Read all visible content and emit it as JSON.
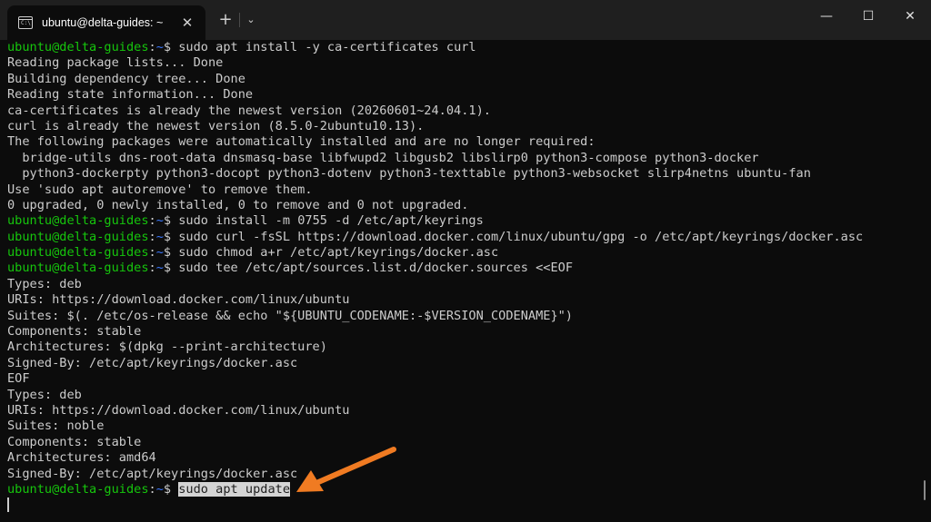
{
  "window": {
    "tab_title": "ubuntu@delta-guides: ~",
    "tab_close": "✕",
    "new_tab": "+",
    "dropdown": "⌄",
    "minimize": "—",
    "maximize": "☐",
    "close": "✕"
  },
  "prompt": {
    "user_host": "ubuntu@delta-guides",
    "separator": ":",
    "path": "~",
    "symbol": "$ "
  },
  "lines": [
    {
      "type": "cmd",
      "text": "sudo apt install -y ca-certificates curl"
    },
    {
      "type": "out",
      "text": "Reading package lists... Done"
    },
    {
      "type": "out",
      "text": "Building dependency tree... Done"
    },
    {
      "type": "out",
      "text": "Reading state information... Done"
    },
    {
      "type": "out",
      "text": "ca-certificates is already the newest version (20260601~24.04.1)."
    },
    {
      "type": "out",
      "text": "curl is already the newest version (8.5.0-2ubuntu10.13)."
    },
    {
      "type": "out",
      "text": "The following packages were automatically installed and are no longer required:"
    },
    {
      "type": "out",
      "text": "  bridge-utils dns-root-data dnsmasq-base libfwupd2 libgusb2 libslirp0 python3-compose python3-docker"
    },
    {
      "type": "out",
      "text": "  python3-dockerpty python3-docopt python3-dotenv python3-texttable python3-websocket slirp4netns ubuntu-fan"
    },
    {
      "type": "out",
      "text": "Use 'sudo apt autoremove' to remove them."
    },
    {
      "type": "out",
      "text": "0 upgraded, 0 newly installed, 0 to remove and 0 not upgraded."
    },
    {
      "type": "cmd",
      "text": "sudo install -m 0755 -d /etc/apt/keyrings"
    },
    {
      "type": "cmd",
      "text": "sudo curl -fsSL https://download.docker.com/linux/ubuntu/gpg -o /etc/apt/keyrings/docker.asc"
    },
    {
      "type": "cmd",
      "text": "sudo chmod a+r /etc/apt/keyrings/docker.asc"
    },
    {
      "type": "cmd",
      "text": "sudo tee /etc/apt/sources.list.d/docker.sources <<EOF"
    },
    {
      "type": "out",
      "text": "Types: deb"
    },
    {
      "type": "out",
      "text": "URIs: https://download.docker.com/linux/ubuntu"
    },
    {
      "type": "out",
      "text": "Suites: $(. /etc/os-release && echo \"${UBUNTU_CODENAME:-$VERSION_CODENAME}\")"
    },
    {
      "type": "out",
      "text": "Components: stable"
    },
    {
      "type": "out",
      "text": "Architectures: $(dpkg --print-architecture)"
    },
    {
      "type": "out",
      "text": "Signed-By: /etc/apt/keyrings/docker.asc"
    },
    {
      "type": "out",
      "text": "EOF"
    },
    {
      "type": "out",
      "text": "Types: deb"
    },
    {
      "type": "out",
      "text": "URIs: https://download.docker.com/linux/ubuntu"
    },
    {
      "type": "out",
      "text": "Suites: noble"
    },
    {
      "type": "out",
      "text": "Components: stable"
    },
    {
      "type": "out",
      "text": "Architectures: amd64"
    },
    {
      "type": "out",
      "text": "Signed-By: /etc/apt/keyrings/docker.asc"
    },
    {
      "type": "cmd",
      "text": "sudo apt update",
      "selected": true
    }
  ],
  "colors": {
    "prompt_user": "#16c60c",
    "prompt_path": "#3b78ff",
    "annotation_arrow": "#f07b22"
  }
}
